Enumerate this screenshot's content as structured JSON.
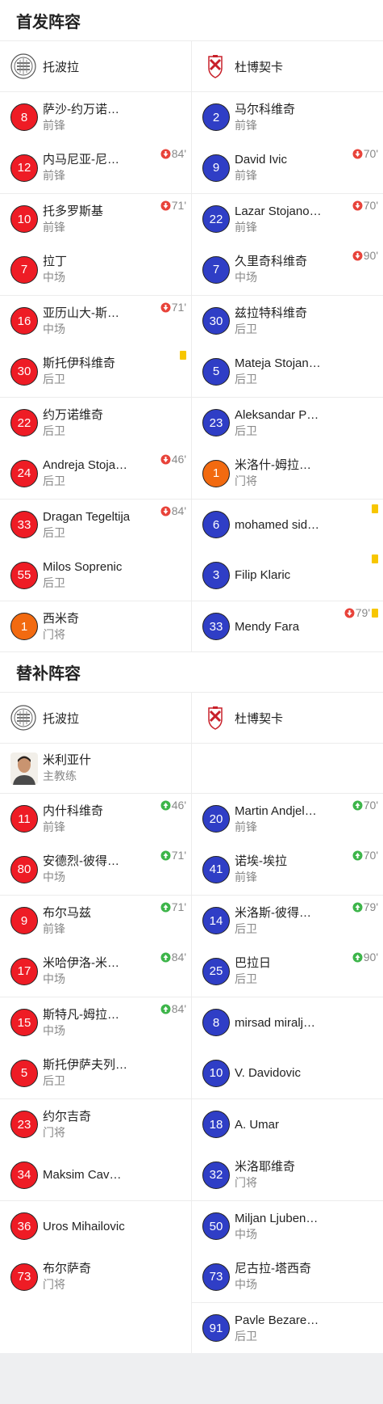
{
  "starters": {
    "title": "首发阵容",
    "home_team": "托波拉",
    "away_team": "杜博契卡",
    "home": [
      {
        "num": "8",
        "color": "red",
        "name": "萨沙-约万诺…",
        "pos": "前锋"
      },
      {
        "num": "12",
        "color": "red",
        "name": "内马尼亚-尼…",
        "pos": "前锋",
        "event": "out",
        "minute": "84'"
      },
      {
        "num": "10",
        "color": "red",
        "name": "托多罗斯基",
        "pos": "前锋",
        "event": "out",
        "minute": "71'"
      },
      {
        "num": "7",
        "color": "red",
        "name": "拉丁",
        "pos": "中场"
      },
      {
        "num": "16",
        "color": "red",
        "name": "亚历山大-斯…",
        "pos": "中场",
        "event": "out",
        "minute": "71'"
      },
      {
        "num": "30",
        "color": "red",
        "name": "斯托伊科维奇",
        "pos": "后卫",
        "yellow": true
      },
      {
        "num": "22",
        "color": "red",
        "name": "约万诺维奇",
        "pos": "后卫"
      },
      {
        "num": "24",
        "color": "red",
        "name": "Andreja Stoja…",
        "pos": "后卫",
        "event": "out",
        "minute": "46'"
      },
      {
        "num": "33",
        "color": "red",
        "name": "Dragan Tegeltija",
        "pos": "后卫",
        "event": "out",
        "minute": "84'"
      },
      {
        "num": "55",
        "color": "red",
        "name": "Milos Soprenic",
        "pos": "后卫"
      },
      {
        "num": "1",
        "color": "orange",
        "name": "西米奇",
        "pos": "门将"
      }
    ],
    "away": [
      {
        "num": "2",
        "color": "blue",
        "name": "马尔科维奇",
        "pos": "前锋"
      },
      {
        "num": "9",
        "color": "blue",
        "name": "David Ivic",
        "pos": "前锋",
        "event": "out",
        "minute": "70'"
      },
      {
        "num": "22",
        "color": "blue",
        "name": "Lazar Stojano…",
        "pos": "前锋",
        "event": "out",
        "minute": "70'"
      },
      {
        "num": "7",
        "color": "blue",
        "name": "久里奇科维奇",
        "pos": "中场",
        "event": "out",
        "minute": "90'"
      },
      {
        "num": "30",
        "color": "blue",
        "name": "兹拉特科维奇",
        "pos": "后卫"
      },
      {
        "num": "5",
        "color": "blue",
        "name": "Mateja Stojan…",
        "pos": "后卫"
      },
      {
        "num": "23",
        "color": "blue",
        "name": "Aleksandar P…",
        "pos": "后卫"
      },
      {
        "num": "1",
        "color": "orange",
        "name": "米洛什-姆拉…",
        "pos": "门将"
      },
      {
        "num": "6",
        "color": "blue",
        "name": "mohamed sid…",
        "pos": "",
        "yellow": true
      },
      {
        "num": "3",
        "color": "blue",
        "name": "Filip Klaric",
        "pos": "",
        "yellow": true
      },
      {
        "num": "33",
        "color": "blue",
        "name": "Mendy Fara",
        "pos": "",
        "event": "out",
        "minute": "79'",
        "yellow": true
      }
    ]
  },
  "subs": {
    "title": "替补阵容",
    "home_team": "托波拉",
    "away_team": "杜博契卡",
    "coach_name": "米利亚什",
    "coach_role": "主教练",
    "home": [
      {
        "num": "11",
        "color": "red",
        "name": "内什科维奇",
        "pos": "前锋",
        "event": "in",
        "minute": "46'"
      },
      {
        "num": "80",
        "color": "red",
        "name": "安德烈-彼得…",
        "pos": "中场",
        "event": "in",
        "minute": "71'"
      },
      {
        "num": "9",
        "color": "red",
        "name": "布尔马兹",
        "pos": "前锋",
        "event": "in",
        "minute": "71'"
      },
      {
        "num": "17",
        "color": "red",
        "name": "米哈伊洛-米…",
        "pos": "中场",
        "event": "in",
        "minute": "84'"
      },
      {
        "num": "15",
        "color": "red",
        "name": "斯特凡-姆拉…",
        "pos": "中场",
        "event": "in",
        "minute": "84'"
      },
      {
        "num": "5",
        "color": "red",
        "name": "斯托伊萨夫列…",
        "pos": "后卫"
      },
      {
        "num": "23",
        "color": "red",
        "name": "约尔吉奇",
        "pos": "门将"
      },
      {
        "num": "34",
        "color": "red",
        "name": "Maksim Cav…",
        "pos": ""
      },
      {
        "num": "36",
        "color": "red",
        "name": "Uros Mihailovic",
        "pos": ""
      },
      {
        "num": "73",
        "color": "red",
        "name": "布尔萨奇",
        "pos": "门将"
      }
    ],
    "away": [
      {
        "num": "20",
        "color": "blue",
        "name": "Martin Andjel…",
        "pos": "前锋",
        "event": "in",
        "minute": "70'"
      },
      {
        "num": "41",
        "color": "blue",
        "name": "诺埃-埃拉",
        "pos": "前锋",
        "event": "in",
        "minute": "70'"
      },
      {
        "num": "14",
        "color": "blue",
        "name": "米洛斯-彼得…",
        "pos": "后卫",
        "event": "in",
        "minute": "79'"
      },
      {
        "num": "25",
        "color": "blue",
        "name": "巴拉日",
        "pos": "后卫",
        "event": "in",
        "minute": "90'"
      },
      {
        "num": "8",
        "color": "blue",
        "name": "mirsad miralj…",
        "pos": ""
      },
      {
        "num": "10",
        "color": "blue",
        "name": "V. Davidovic",
        "pos": ""
      },
      {
        "num": "18",
        "color": "blue",
        "name": "A. Umar",
        "pos": ""
      },
      {
        "num": "32",
        "color": "blue",
        "name": "米洛耶维奇",
        "pos": "门将"
      },
      {
        "num": "50",
        "color": "blue",
        "name": "Miljan Ljuben…",
        "pos": "中场"
      },
      {
        "num": "73",
        "color": "blue",
        "name": "尼古拉-塔西奇",
        "pos": "中场"
      },
      {
        "num": "91",
        "color": "blue",
        "name": "Pavle Bezare…",
        "pos": "后卫"
      }
    ]
  },
  "colors": {
    "home_kit": "#ee1c25",
    "away_kit": "#2f3ec6",
    "goalkeeper": "#f26a10",
    "sub_in": "#3db54a",
    "sub_out": "#e8433a",
    "yellow_card": "#f7c600"
  }
}
